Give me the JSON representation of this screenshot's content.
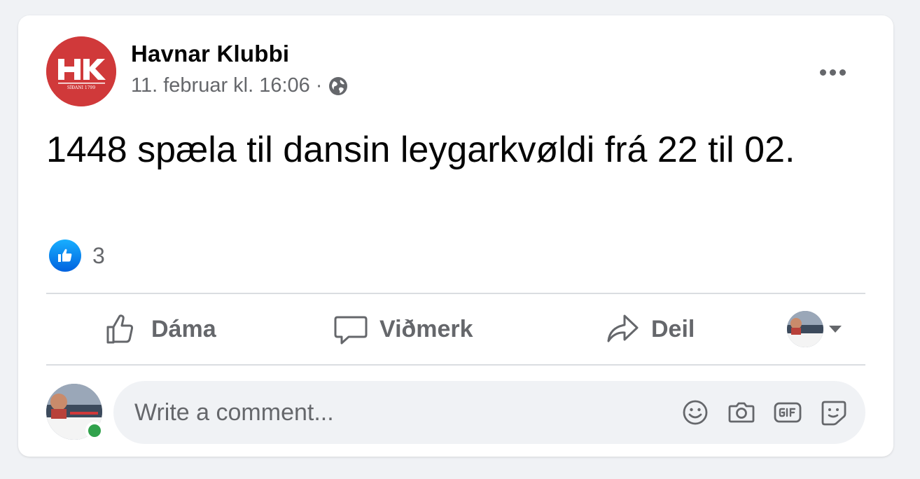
{
  "post": {
    "author": "Havnar Klubbi",
    "logo_letters": "HK",
    "logo_tagline": "SÍÐANI 1799",
    "timestamp": "11. februar kl. 16:06",
    "separator": "·",
    "audience_icon": "globe-icon",
    "text": "1448 spæla til dansin leygarkvøldi frá 22 til 02.",
    "reactions": {
      "icon": "like-icon",
      "count": "3"
    }
  },
  "actions": {
    "like_label": "Dáma",
    "comment_label": "Viðmerk",
    "share_label": "Deil"
  },
  "composer": {
    "placeholder": "Write a comment...",
    "icons": [
      "emoji-icon",
      "camera-icon",
      "gif-icon",
      "sticker-icon"
    ]
  },
  "colors": {
    "background": "#f0f2f5",
    "card": "#ffffff",
    "text_primary": "#050505",
    "text_secondary": "#65676b",
    "brand_red": "#d0393a",
    "like_blue": "#1877f2",
    "online_green": "#31a24c"
  }
}
